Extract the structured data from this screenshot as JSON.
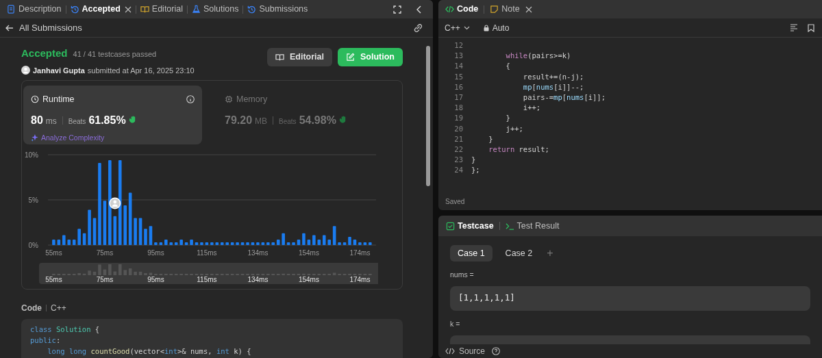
{
  "left_tabs": [
    {
      "label": "Description",
      "selected": false,
      "closable": false
    },
    {
      "label": "Accepted",
      "selected": true,
      "closable": true
    },
    {
      "label": "Editorial",
      "selected": false,
      "closable": false
    },
    {
      "label": "Solutions",
      "selected": false,
      "closable": false
    },
    {
      "label": "Submissions",
      "selected": false,
      "closable": false
    }
  ],
  "back_link": "All Submissions",
  "submission": {
    "status": "Accepted",
    "testcases": "41 / 41 testcases passed",
    "author": "Janhavi Gupta",
    "submitted": "submitted at Apr 16, 2025 23:10",
    "buttons": [
      {
        "label": "Editorial",
        "kind": "secondary"
      },
      {
        "label": "Solution",
        "kind": "primary"
      }
    ]
  },
  "stats": [
    {
      "title": "Runtime",
      "value": "80",
      "unit": "ms",
      "beats_label": "Beats",
      "beats": "61.85%",
      "selected": true,
      "link": "Analyze Complexity"
    },
    {
      "title": "Memory",
      "value": "79.20",
      "unit": "MB",
      "beats_label": "Beats",
      "beats": "54.98%",
      "selected": false
    }
  ],
  "chart_data": {
    "type": "bar",
    "ylim": [
      0,
      10
    ],
    "yticks": [
      {
        "value": 0,
        "label": "0%"
      },
      {
        "value": 5,
        "label": "5%"
      },
      {
        "value": 10,
        "label": "10%"
      }
    ],
    "categories": [
      "55ms",
      null,
      null,
      null,
      null,
      null,
      null,
      null,
      null,
      null,
      "75ms",
      null,
      null,
      null,
      null,
      null,
      null,
      null,
      null,
      null,
      "95ms",
      null,
      null,
      null,
      null,
      null,
      null,
      null,
      null,
      null,
      "115ms",
      null,
      null,
      null,
      null,
      null,
      null,
      null,
      null,
      null,
      "134ms",
      null,
      null,
      null,
      null,
      null,
      null,
      null,
      null,
      null,
      "154ms",
      null,
      null,
      null,
      null,
      null,
      null,
      null,
      null,
      null,
      "174ms",
      null,
      null
    ],
    "series": [
      {
        "color": "#1a7cf0",
        "values": [
          0.6,
          0.6,
          1.1,
          0.6,
          0.6,
          1.8,
          1.3,
          3.9,
          3.0,
          9.1,
          4.9,
          9.4,
          3.2,
          9.4,
          4.4,
          5.8,
          3.0,
          3.0,
          1.8,
          2.1,
          0.3,
          0.3,
          0.6,
          0.3,
          0.3,
          0.6,
          0.3,
          0.6,
          0.3,
          0.3,
          0.3,
          0.3,
          0.3,
          0.3,
          0.3,
          0.3,
          0.3,
          0.3,
          0.3,
          0.3,
          0.3,
          0.3,
          0.3,
          0.3,
          0.6,
          1.3,
          0.3,
          0.3,
          0.6,
          1.3,
          0.6,
          1.1,
          0.6,
          1.1,
          0.6,
          2.1,
          0.3,
          0.3,
          0.9,
          0.6,
          0.3,
          0.3,
          0.3
        ]
      }
    ]
  },
  "overview_labels": [
    "55ms",
    "75ms",
    "95ms",
    "115ms",
    "134ms",
    "154ms",
    "174ms"
  ],
  "code_header": {
    "title": "Code",
    "language": "C++"
  },
  "left_code": [
    [
      {
        "text": "class ",
        "kind": "keyword"
      },
      {
        "text": "Solution",
        "kind": "type"
      },
      {
        "text": " {",
        "kind": "plain"
      }
    ],
    [
      {
        "text": "public",
        "kind": "keyword"
      },
      {
        "text": ":",
        "kind": "plain"
      }
    ],
    [
      {
        "text": "    long long ",
        "kind": "keyword"
      },
      {
        "text": "countGood",
        "kind": "function"
      },
      {
        "text": "(vector<",
        "kind": "plain"
      },
      {
        "text": "int",
        "kind": "keyword"
      },
      {
        "text": ">& nums, ",
        "kind": "plain"
      },
      {
        "text": "int",
        "kind": "keyword"
      },
      {
        "text": " k) {",
        "kind": "plain"
      }
    ]
  ],
  "right_tabs": [
    {
      "label": "Code",
      "selected": true,
      "closable": false
    },
    {
      "label": "Note",
      "selected": false,
      "closable": true
    }
  ],
  "editor": {
    "language": "C++",
    "mode": "Auto",
    "status": "Saved",
    "lines": [
      {
        "number": "12"
      },
      {
        "number": "13",
        "tokens": [
          {
            "text": "        while",
            "kind": "control"
          },
          {
            "text": "(pairs>=k)",
            "kind": "plain"
          }
        ]
      },
      {
        "number": "14",
        "tokens": [
          {
            "text": "        {",
            "kind": "plain"
          }
        ]
      },
      {
        "number": "15",
        "tokens": [
          {
            "text": "            result+=(n-j);",
            "kind": "plain"
          }
        ]
      },
      {
        "number": "16",
        "tokens": [
          {
            "text": "            mp",
            "kind": "variable"
          },
          {
            "text": "[",
            "kind": "plain"
          },
          {
            "text": "nums",
            "kind": "variable"
          },
          {
            "text": "[i]]--;",
            "kind": "plain"
          }
        ]
      },
      {
        "number": "17",
        "tokens": [
          {
            "text": "            pairs-=",
            "kind": "plain"
          },
          {
            "text": "mp",
            "kind": "variable"
          },
          {
            "text": "[",
            "kind": "plain"
          },
          {
            "text": "nums",
            "kind": "variable"
          },
          {
            "text": "[i]];",
            "kind": "plain"
          }
        ]
      },
      {
        "number": "18",
        "tokens": [
          {
            "text": "            i++;",
            "kind": "plain"
          }
        ]
      },
      {
        "number": "19",
        "tokens": [
          {
            "text": "        }",
            "kind": "plain"
          }
        ]
      },
      {
        "number": "20",
        "tokens": [
          {
            "text": "        j++;",
            "kind": "plain"
          }
        ]
      },
      {
        "number": "21",
        "tokens": [
          {
            "text": "    }",
            "kind": "plain"
          }
        ]
      },
      {
        "number": "22",
        "tokens": [
          {
            "text": "    return",
            "kind": "control"
          },
          {
            "text": " result;",
            "kind": "plain"
          }
        ]
      },
      {
        "number": "23",
        "tokens": [
          {
            "text": "}",
            "kind": "plain"
          }
        ]
      },
      {
        "number": "24",
        "tokens": [
          {
            "text": "};",
            "kind": "plain"
          }
        ]
      }
    ]
  },
  "bottom_tabs": [
    {
      "label": "Testcase",
      "selected": true
    },
    {
      "label": "Test Result",
      "selected": false
    }
  ],
  "cases": [
    {
      "label": "Case 1",
      "selected": true
    },
    {
      "label": "Case 2",
      "selected": false
    }
  ],
  "add_case": "+",
  "params": [
    {
      "label": "nums =",
      "value": "[1,1,1,1,1]"
    },
    {
      "label": "k ="
    }
  ],
  "footer": {
    "label": "Source"
  }
}
